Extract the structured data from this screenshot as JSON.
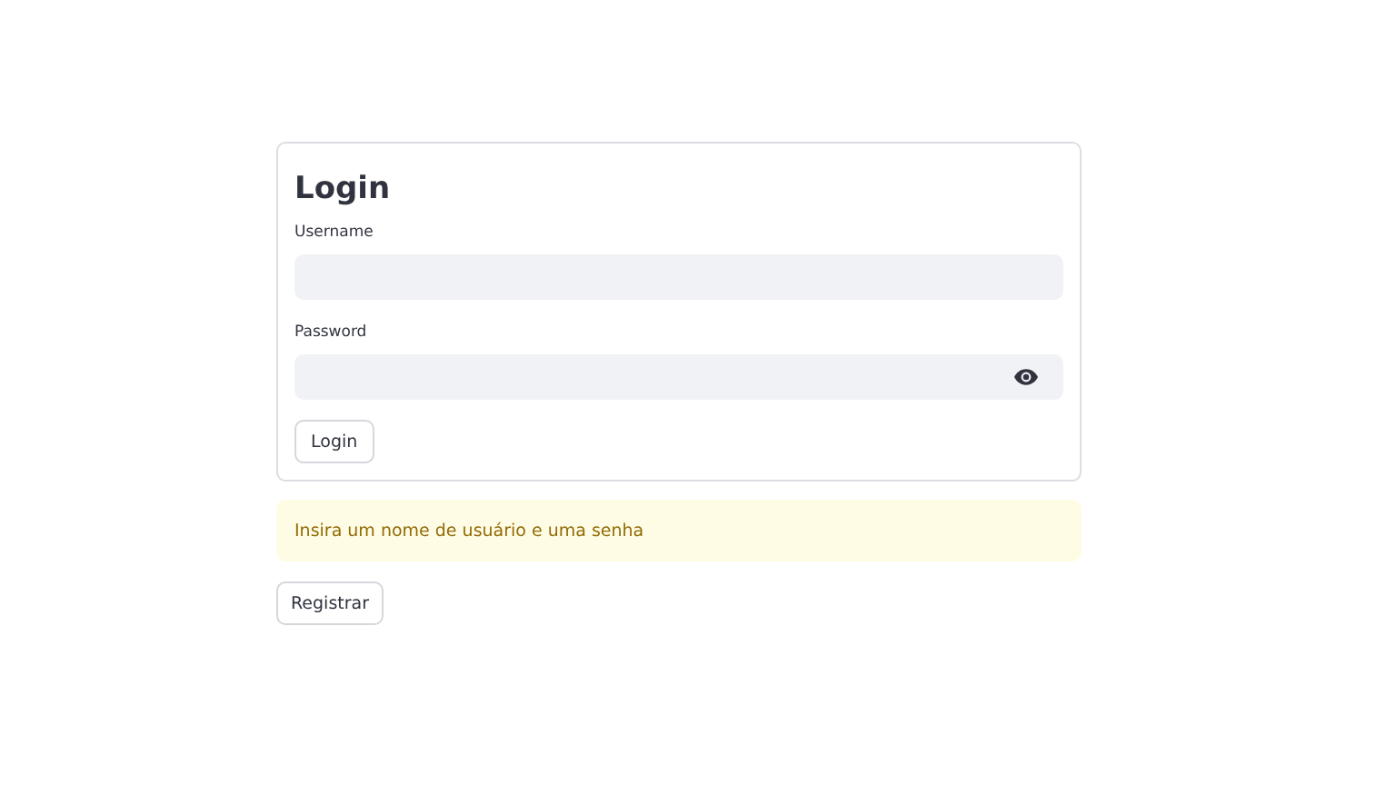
{
  "form": {
    "title": "Login",
    "fields": [
      {
        "kind": "text",
        "label": "Username"
      },
      {
        "kind": "password",
        "label": "Password"
      }
    ],
    "submit": "Login"
  },
  "warning": "Insira um nome de usuário e uma senha",
  "register_button": "Registrar"
}
